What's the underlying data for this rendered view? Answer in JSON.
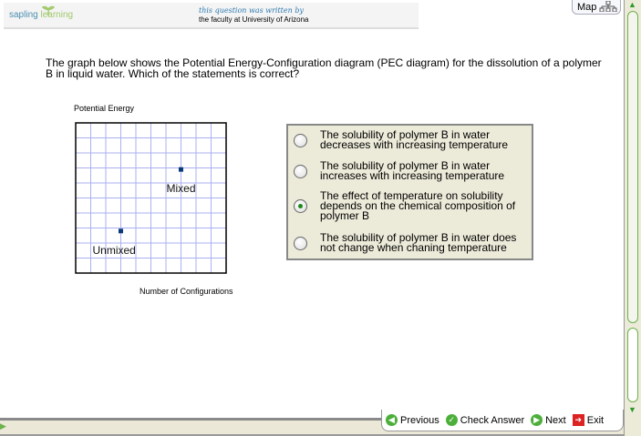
{
  "header": {
    "logo_part1": "sapling",
    "logo_part2": "learning",
    "credit_line1": "this question was written by",
    "credit_line2": "the faculty at University of Arizona"
  },
  "map_label": "Map",
  "question": "The graph below shows the Potential Energy-Configuration diagram (PEC diagram) for the dissolution of a polymer B in liquid water. Which of the statements is correct?",
  "chart_data": {
    "type": "scatter",
    "ylabel": "Potential Energy",
    "xlabel": "Number of Configurations",
    "xlim": [
      0,
      10
    ],
    "ylim": [
      0,
      10
    ],
    "grid": true,
    "points": [
      {
        "label": "Unmixed",
        "x": 3,
        "y": 2.8
      },
      {
        "label": "Mixed",
        "x": 7,
        "y": 6.9
      }
    ]
  },
  "choices": [
    {
      "text": "The solubility of polymer B in water decreases with increasing temperature",
      "selected": false
    },
    {
      "text": "The solubility of polymer B in water increases with increasing temperature",
      "selected": false
    },
    {
      "text": "The effect of temperature on solubility depends on the chemical composition of polymer B",
      "selected": true
    },
    {
      "text": "The solubility of polymer B in water does not change when chaning temperature",
      "selected": false
    }
  ],
  "nav": {
    "previous": "Previous",
    "check": "Check Answer",
    "next": "Next",
    "exit": "Exit"
  }
}
